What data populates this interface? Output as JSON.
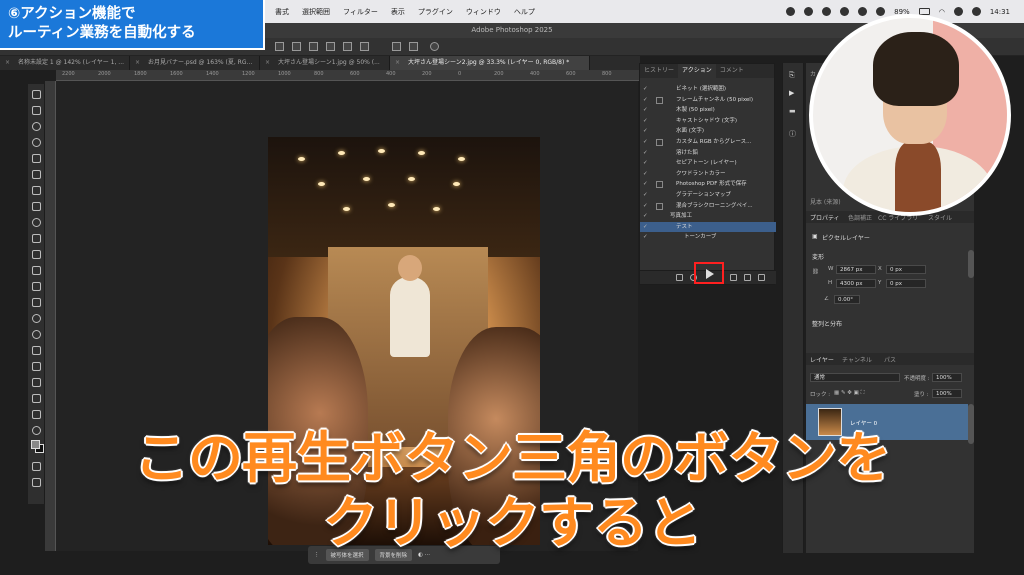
{
  "badge": {
    "line1": "⑥アクション機能で",
    "line2": "ルーティン業務を自動化する"
  },
  "menubar": {
    "items": [
      "書式",
      "選択範囲",
      "フィルター",
      "表示",
      "プラグイン",
      "ウィンドウ",
      "ヘルプ"
    ],
    "battery": "89%",
    "clock": "14:31"
  },
  "window": {
    "title": "Adobe Photoshop 2025"
  },
  "tabs": [
    "名称未設定 1 @ 142% (レイヤー 1, ...",
    "お月見バナー.psd @ 163% (夏, RG...",
    "大坪さん登場シーン1.jpg @ 50% (...",
    "大坪さん登場シーン2.jpg @ 33.3% (レイヤー 0, RGB/8) *"
  ],
  "ruler": [
    "2200",
    "2000",
    "1800",
    "1600",
    "1400",
    "1200",
    "1000",
    "800",
    "600",
    "400",
    "200",
    "0",
    "200",
    "400",
    "600",
    "800"
  ],
  "actions_panel": {
    "tabs": [
      "ヒストリー",
      "アクション",
      "コメント"
    ],
    "rows": [
      {
        "label": "ビネット (選択範囲)",
        "kind": "action"
      },
      {
        "label": "フレームチャンネル (50 pixel)",
        "kind": "action"
      },
      {
        "label": "木製 (50 pixel)",
        "kind": "action"
      },
      {
        "label": "キャストシャドウ (文字)",
        "kind": "action"
      },
      {
        "label": "水面 (文字)",
        "kind": "action"
      },
      {
        "label": "カスタム RGB からグレース...",
        "kind": "action"
      },
      {
        "label": "溶けた鉛",
        "kind": "action"
      },
      {
        "label": "セピアトーン (レイヤー)",
        "kind": "action"
      },
      {
        "label": "クワドラントカラー",
        "kind": "action"
      },
      {
        "label": "Photoshop PDF 形式で保存",
        "kind": "action"
      },
      {
        "label": "グラデーションマップ",
        "kind": "action"
      },
      {
        "label": "混合ブラシクローニングペイ...",
        "kind": "action"
      },
      {
        "label": "写真加工",
        "kind": "set"
      },
      {
        "label": "テスト",
        "kind": "selected"
      },
      {
        "label": "トーンカーブ",
        "kind": "sub"
      }
    ]
  },
  "right": {
    "top_tabs": [
      "カ"
    ],
    "top_field": "見本 (来源)",
    "props_tabs": [
      "プロパティ",
      "色調補正",
      "CC ライブラリ",
      "スタイル"
    ],
    "layer_type": "ピクセルレイヤー",
    "transform_label": "変形",
    "w_label": "W",
    "w_value": "2867 px",
    "h_label": "H",
    "h_value": "4300 px",
    "x_label": "X",
    "x_value": "0 px",
    "y_label": "Y",
    "y_value": "0 px",
    "angle_value": "0.00°",
    "align_label": "整列と分布",
    "layers_tabs": [
      "レイヤー",
      "チャンネル",
      "パス"
    ],
    "blend_mode": "通常",
    "opacity_label": "不透明度 :",
    "opacity_value": "100%",
    "lock_label": "ロック :",
    "fill_label": "塗り :",
    "fill_value": "100%",
    "layer_name": "レイヤー 0"
  },
  "context_bar": {
    "select": "被写体を選択",
    "remove": "背景を削除"
  },
  "subtitle": {
    "line1": "この再生ボタン三角のボタンを",
    "line2": "クリックすると"
  }
}
